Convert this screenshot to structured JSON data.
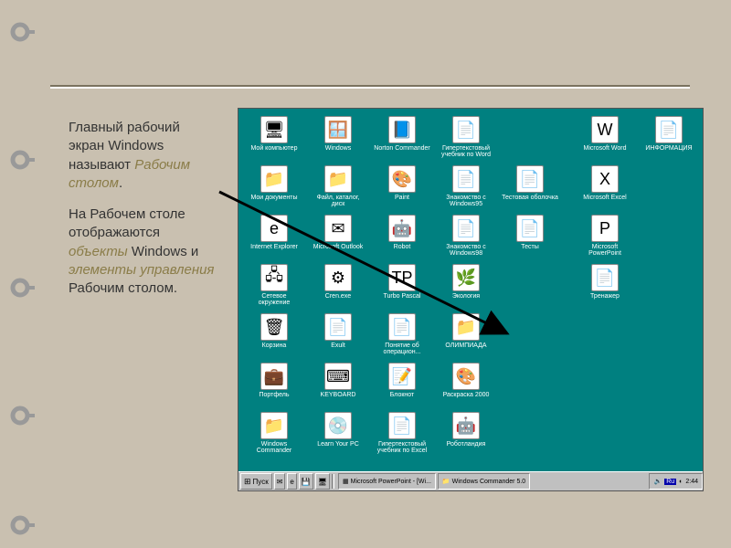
{
  "text": {
    "p1a": "Главный рабочий экран Windows называют ",
    "p1b": "Рабочим столом",
    "p1c": ".",
    "p2a": "На Рабочем столе отображаются ",
    "p2b": "объекты",
    "p2c": " Windows и ",
    "p2d": "элементы управления",
    "p2e": " Рабочим столом."
  },
  "icons": [
    {
      "row": 0,
      "col": 0,
      "label": "Мой компьютер",
      "glyph": "🖥"
    },
    {
      "row": 0,
      "col": 1,
      "label": "Windows",
      "glyph": "🪟"
    },
    {
      "row": 0,
      "col": 2,
      "label": "Norton Commander",
      "glyph": "📘"
    },
    {
      "row": 0,
      "col": 3,
      "label": "Гипертекстовый учебник по Word",
      "glyph": "📄"
    },
    {
      "row": 0,
      "col": 5,
      "label": "Microsoft Word",
      "glyph": "W"
    },
    {
      "row": 0,
      "col": 6,
      "label": "ИНФОРМАЦИЯ",
      "glyph": "📄"
    },
    {
      "row": 1,
      "col": 0,
      "label": "Мои документы",
      "glyph": "📁"
    },
    {
      "row": 1,
      "col": 1,
      "label": "Файл, каталог, диск",
      "glyph": "📁"
    },
    {
      "row": 1,
      "col": 2,
      "label": "Paint",
      "glyph": "🎨"
    },
    {
      "row": 1,
      "col": 3,
      "label": "Знакомство с Windows95",
      "glyph": "📄"
    },
    {
      "row": 1,
      "col": 4,
      "label": "Тестовая оболочка",
      "glyph": "📄"
    },
    {
      "row": 1,
      "col": 5,
      "label": "Microsoft Excel",
      "glyph": "X"
    },
    {
      "row": 2,
      "col": 0,
      "label": "Internet Explorer",
      "glyph": "e"
    },
    {
      "row": 2,
      "col": 1,
      "label": "Microsoft Outlook",
      "glyph": "✉"
    },
    {
      "row": 2,
      "col": 2,
      "label": "Robot",
      "glyph": "🤖"
    },
    {
      "row": 2,
      "col": 3,
      "label": "Знакомство с Windows98",
      "glyph": "📄"
    },
    {
      "row": 2,
      "col": 4,
      "label": "Тесты",
      "glyph": "📄"
    },
    {
      "row": 2,
      "col": 5,
      "label": "Microsoft PowerPoint",
      "glyph": "P"
    },
    {
      "row": 3,
      "col": 0,
      "label": "Сетевое окружение",
      "glyph": "🖧"
    },
    {
      "row": 3,
      "col": 1,
      "label": "Cren.exe",
      "glyph": "⚙"
    },
    {
      "row": 3,
      "col": 2,
      "label": "Turbo Pascal",
      "glyph": "TP"
    },
    {
      "row": 3,
      "col": 3,
      "label": "Экология",
      "glyph": "🌿"
    },
    {
      "row": 3,
      "col": 5,
      "label": "Тренажер",
      "glyph": "📄"
    },
    {
      "row": 4,
      "col": 0,
      "label": "Корзина",
      "glyph": "🗑"
    },
    {
      "row": 4,
      "col": 1,
      "label": "Exult",
      "glyph": "📄"
    },
    {
      "row": 4,
      "col": 2,
      "label": "Понятие об операцион...",
      "glyph": "📄"
    },
    {
      "row": 4,
      "col": 3,
      "label": "ОЛИМПИАДА",
      "glyph": "📁"
    },
    {
      "row": 5,
      "col": 0,
      "label": "Портфель",
      "glyph": "💼"
    },
    {
      "row": 5,
      "col": 1,
      "label": "KEYBOARD",
      "glyph": "⌨"
    },
    {
      "row": 5,
      "col": 2,
      "label": "Блокнот",
      "glyph": "📝"
    },
    {
      "row": 5,
      "col": 3,
      "label": "Раскраска 2000",
      "glyph": "🎨"
    },
    {
      "row": 6,
      "col": 0,
      "label": "Windows Commander",
      "glyph": "📁"
    },
    {
      "row": 6,
      "col": 1,
      "label": "Learn Your PC",
      "glyph": "💿"
    },
    {
      "row": 6,
      "col": 2,
      "label": "Гипертекстовый учебник по Excel",
      "glyph": "📄"
    },
    {
      "row": 6,
      "col": 3,
      "label": "Роботландия",
      "glyph": "🤖"
    }
  ],
  "taskbar": {
    "start": "Пуск",
    "tasks": [
      "Microsoft PowerPoint - [Wi...",
      "Windows Commander 5.0"
    ],
    "lang": "Ru",
    "time": "2:44"
  }
}
